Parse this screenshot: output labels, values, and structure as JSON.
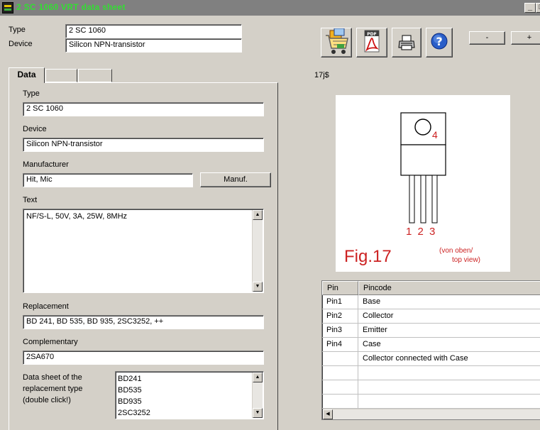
{
  "window": {
    "title": "2 SC 1060 VRT data sheet"
  },
  "header": {
    "type_label": "Type",
    "type_value": "2 SC 1060",
    "device_label": "Device",
    "device_value": "Silicon NPN-transistor"
  },
  "toolbar": {
    "icons": [
      "shopping-cart-icon",
      "pdf-icon",
      "printer-icon",
      "help-icon"
    ],
    "zoom_out_label": "-",
    "zoom_in_label": "+"
  },
  "tabs": [
    "Data",
    "",
    ""
  ],
  "form": {
    "type_label": "Type",
    "type_value": "2 SC 1060",
    "device_label": "Device",
    "device_value": "Silicon NPN-transistor",
    "manufacturer_label": "Manufacturer",
    "manufacturer_value": "Hit, Mic",
    "manuf_button": "Manuf.",
    "text_label": "Text",
    "text_value": "NF/S-L, 50V, 3A, 25W, 8MHz",
    "replacement_label": "Replacement",
    "replacement_value": "BD 241, BD 535, BD 935, 2SC3252, ++",
    "complementary_label": "Complementary",
    "complementary_value": "2SA670",
    "datasheet_label_1": "Data sheet of the",
    "datasheet_label_2": "replacement type",
    "datasheet_label_3": "(double click!)",
    "replacement_list": [
      "BD241",
      "BD535",
      "BD935",
      "2SC3252"
    ]
  },
  "figure": {
    "code": "17j$",
    "pin_numbers": "1 2 3",
    "tab_pin": "4",
    "caption": "Fig.17",
    "view_note_1": "(von oben/",
    "view_note_2": "top view)",
    "colors": {
      "red": "#cc2222"
    }
  },
  "pin_table": {
    "headers": [
      "Pin",
      "Pincode"
    ],
    "rows": [
      [
        "Pin1",
        "Base"
      ],
      [
        "Pin2",
        "Collector"
      ],
      [
        "Pin3",
        "Emitter"
      ],
      [
        "Pin4",
        "Case"
      ],
      [
        "",
        "Collector connected with Case"
      ]
    ]
  }
}
